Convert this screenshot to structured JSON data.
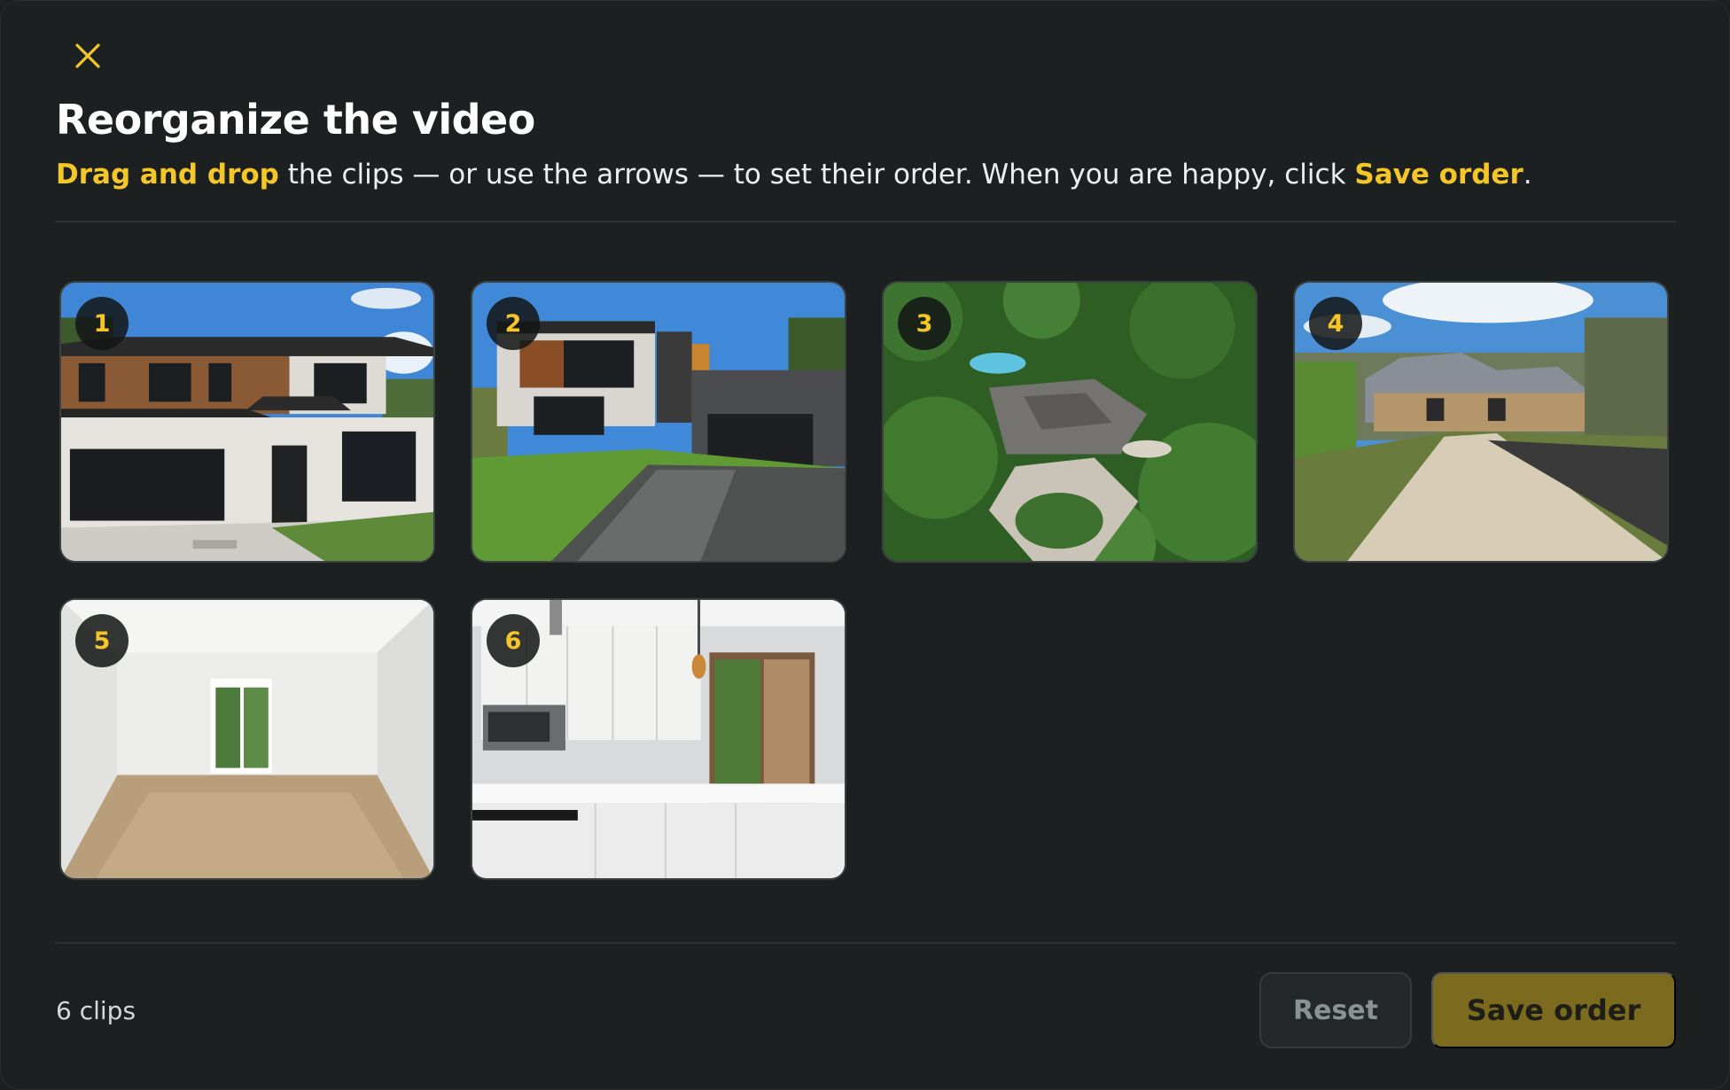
{
  "dialog": {
    "title": "Reorganize the video",
    "instructions": {
      "highlight_1": "Drag and drop",
      "text_1": " the clips — or use the arrows — to set their order. When you are happy, click ",
      "highlight_2": "Save order",
      "text_2": "."
    },
    "close_icon": "close-icon"
  },
  "clips": [
    {
      "number": "1",
      "scene": "modern-house-exterior"
    },
    {
      "number": "2",
      "scene": "modern-house-driveway"
    },
    {
      "number": "3",
      "scene": "aerial-estate-with-pool"
    },
    {
      "number": "4",
      "scene": "brick-house-curved-driveway"
    },
    {
      "number": "5",
      "scene": "empty-living-room"
    },
    {
      "number": "6",
      "scene": "white-kitchen"
    }
  ],
  "footer": {
    "count_label": "6 clips",
    "reset_label": "Reset",
    "save_label": "Save order"
  },
  "colors": {
    "accent": "#f5c628",
    "background": "#1c2020",
    "save_button": "#7c6a1f"
  }
}
